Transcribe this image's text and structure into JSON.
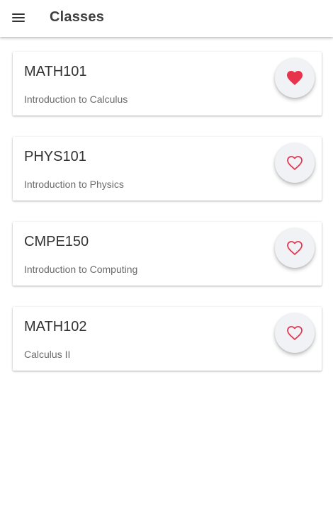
{
  "app_bar": {
    "title": "Classes",
    "menu_icon": "hamburger-menu-icon"
  },
  "colors": {
    "accent": "#e8334d",
    "fab_background": "#f1f2f6"
  },
  "classes": [
    {
      "code": "MATH101",
      "name": "Introduction to Calculus",
      "favorite": true
    },
    {
      "code": "PHYS101",
      "name": "Introduction to Physics",
      "favorite": false
    },
    {
      "code": "CMPE150",
      "name": "Introduction to Computing",
      "favorite": false
    },
    {
      "code": "MATH102",
      "name": "Calculus II",
      "favorite": false
    }
  ]
}
